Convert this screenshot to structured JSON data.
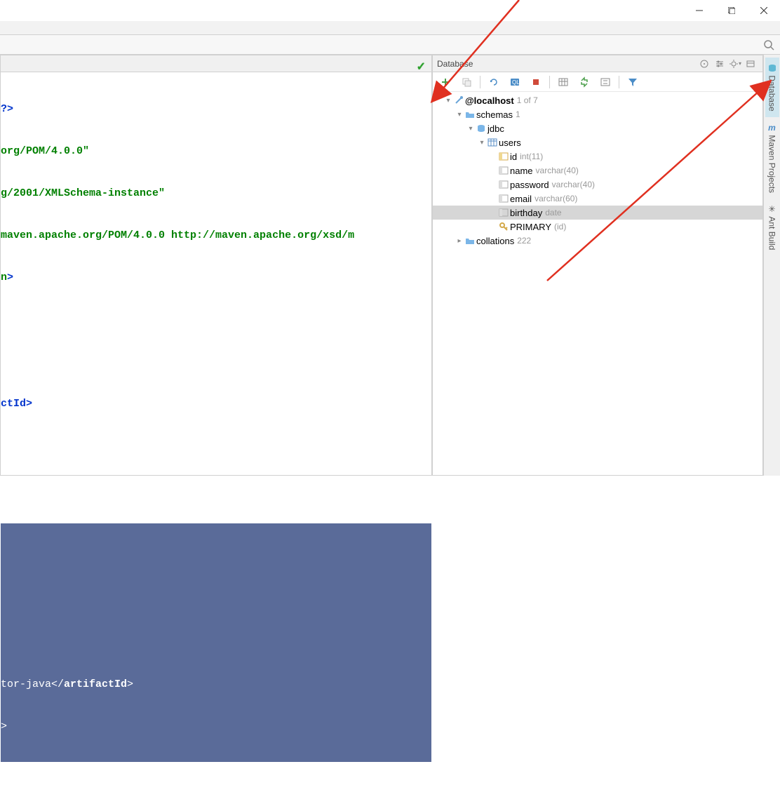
{
  "window": {
    "minimize": "—",
    "maximize": "❐",
    "close": "✕"
  },
  "db_panel": {
    "title": "Database",
    "connection": {
      "name": "@localhost",
      "meta": "1 of 7"
    },
    "schemas": {
      "label": "schemas",
      "meta": "1"
    },
    "db_name": "jdbc",
    "table": "users",
    "columns": [
      {
        "name": "id",
        "type": "int(11)",
        "pk": true
      },
      {
        "name": "name",
        "type": "varchar(40)",
        "pk": false
      },
      {
        "name": "password",
        "type": "varchar(40)",
        "pk": false
      },
      {
        "name": "email",
        "type": "varchar(60)",
        "pk": false
      },
      {
        "name": "birthday",
        "type": "date",
        "pk": false
      }
    ],
    "primary_key": {
      "label": "PRIMARY",
      "meta": "(id)"
    },
    "collations": {
      "label": "collations",
      "meta": "222"
    }
  },
  "right_tabs": {
    "database": "Database",
    "maven": "Maven Projects",
    "ant": "Ant Build"
  },
  "code": {
    "l1": "?>",
    "l2a": "org/POM/4.0.0\"",
    "l3a": "g/2001/XMLSchema-instance\"",
    "l4": "maven.apache.org/POM/4.0.0 http://maven.apache.org/xsd/m",
    "l5a": "n",
    "l5b": ">",
    "l7": "ctId>",
    "s1": "tor-java</",
    "s1b": "artifactId",
    "s1c": ">",
    "s2": ">"
  },
  "icons": {
    "search": "search",
    "plus": "plus",
    "copy": "copy",
    "refresh": "refresh",
    "console": "console",
    "stop": "stop",
    "table": "table",
    "sync": "sync",
    "collapse": "collapse",
    "filter": "filter",
    "target": "target",
    "settings": "settings",
    "gear": "gear"
  }
}
